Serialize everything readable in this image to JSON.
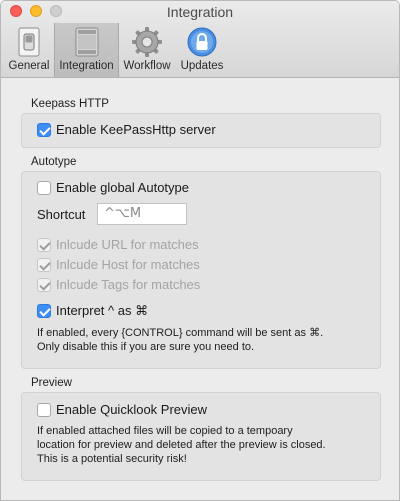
{
  "window": {
    "title": "Integration"
  },
  "toolbar": {
    "items": [
      {
        "label": "General",
        "icon": "switch-icon",
        "selected": false
      },
      {
        "label": "Integration",
        "icon": "mac-pro-icon",
        "selected": true
      },
      {
        "label": "Workflow",
        "icon": "gear-icon",
        "selected": false
      },
      {
        "label": "Updates",
        "icon": "lock-icon",
        "selected": false
      }
    ]
  },
  "keepass": {
    "section": "Keepass HTTP",
    "enable_label": "Enable KeePassHttp server",
    "enable_checked": true
  },
  "autotype": {
    "section": "Autotype",
    "global_label": "Enable global Autotype",
    "global_checked": false,
    "shortcut_label": "Shortcut",
    "shortcut_value": "^⌥M",
    "url_label": "Inlcude URL for matches",
    "host_label": "Inlcude Host for matches",
    "tags_label": "Inlcude Tags for matches",
    "interpret_label": "Interpret ^ as ⌘",
    "interpret_checked": true,
    "note_line1": "If enabled, every {CONTROL} command will be sent as ⌘.",
    "note_line2": "Only disable this if you are sure you need to."
  },
  "preview": {
    "section": "Preview",
    "quicklook_label": "Enable Quicklook Preview",
    "quicklook_checked": false,
    "note_line1": "If enabled attached files will be copied to a tempoary",
    "note_line2": "location for preview and deleted after the preview is closed.",
    "note_line3": "This is a potential security risk!"
  },
  "colors": {
    "accent": "#3d8ef7",
    "close": "#fc5f57",
    "minimize": "#fdbc2e"
  }
}
